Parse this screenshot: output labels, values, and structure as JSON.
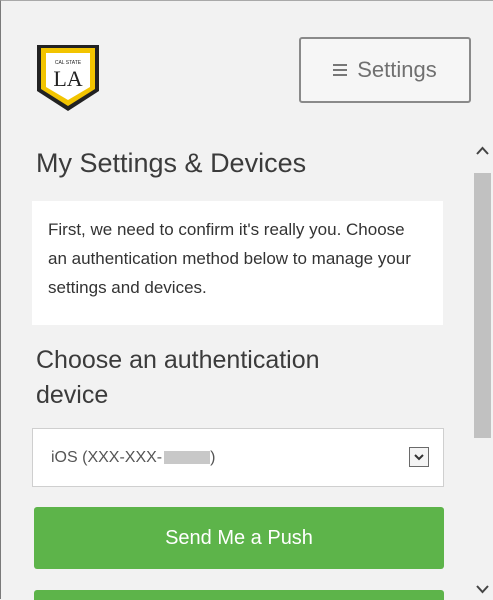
{
  "header": {
    "logo": {
      "small_text": "CAL STATE",
      "big_text": "LA"
    },
    "settings_button": {
      "label": "Settings",
      "icon": "hamburger-menu-icon"
    }
  },
  "main": {
    "title": "My Settings & Devices",
    "info_text": "First, we need to confirm it's really you. Choose an authentication method below to manage your settings and devices.",
    "section_label": "Choose an authentication device",
    "device_select": {
      "selected_value": "iOS (XXX-XXX-",
      "selected_suffix": ")",
      "icon": "chevron-down-icon"
    },
    "push_button": {
      "label": "Send Me a Push"
    }
  },
  "colors": {
    "accent_green": "#5db44a",
    "logo_gold": "#f2c400",
    "logo_dark": "#222222"
  },
  "scrollbar": {
    "up_icon": "chevron-up-icon",
    "down_icon": "chevron-down-icon"
  }
}
